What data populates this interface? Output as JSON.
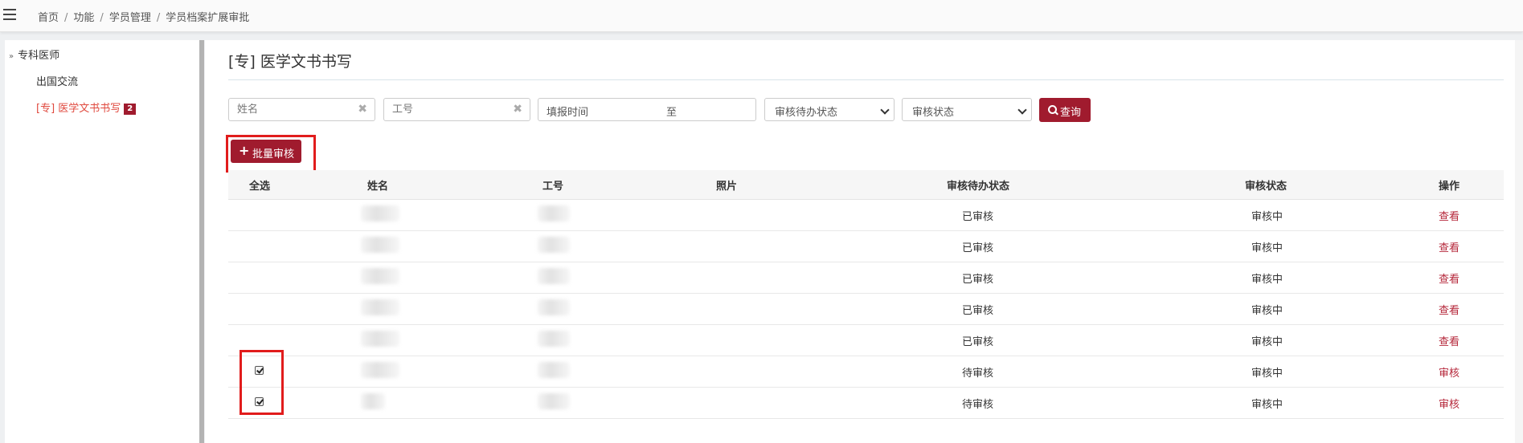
{
  "breadcrumb": [
    "首页",
    "功能",
    "学员管理",
    "学员档案扩展审批"
  ],
  "sidebar": {
    "root_label": "专科医师",
    "items": [
      {
        "label": "出国交流",
        "active": false
      },
      {
        "label": "[专] 医学文书书写",
        "badge": "2",
        "active": true
      }
    ]
  },
  "page": {
    "title": "[专] 医学文书书写"
  },
  "filters": {
    "name_placeholder": "姓名",
    "id_placeholder": "工号",
    "date_start_placeholder": "填报时间",
    "date_separator": "至",
    "pending_status_placeholder": "审核待办状态",
    "audit_status_placeholder": "审核状态",
    "query_label": "查询"
  },
  "actions": {
    "batch_label": "批量审核"
  },
  "table": {
    "headers": {
      "select_all": "全选",
      "name": "姓名",
      "staff_id": "工号",
      "photo": "照片",
      "pending_status": "审核待办状态",
      "audit_status": "审核状态",
      "operation": "操作"
    },
    "rows": [
      {
        "checked": false,
        "pending_status": "已审核",
        "audit_status": "审核中",
        "operation": "查看"
      },
      {
        "checked": false,
        "pending_status": "已审核",
        "audit_status": "审核中",
        "operation": "查看"
      },
      {
        "checked": false,
        "pending_status": "已审核",
        "audit_status": "审核中",
        "operation": "查看"
      },
      {
        "checked": false,
        "pending_status": "已审核",
        "audit_status": "审核中",
        "operation": "查看"
      },
      {
        "checked": false,
        "pending_status": "已审核",
        "audit_status": "审核中",
        "operation": "查看"
      },
      {
        "checked": true,
        "pending_status": "待审核",
        "audit_status": "审核中",
        "operation": "审核"
      },
      {
        "checked": true,
        "pending_status": "待审核",
        "audit_status": "审核中",
        "operation": "审核"
      }
    ]
  },
  "colors": {
    "accent": "#a01b2e",
    "link": "#b5273a",
    "active_nav": "#e04a3f",
    "highlight_box": "#e11c1c"
  }
}
